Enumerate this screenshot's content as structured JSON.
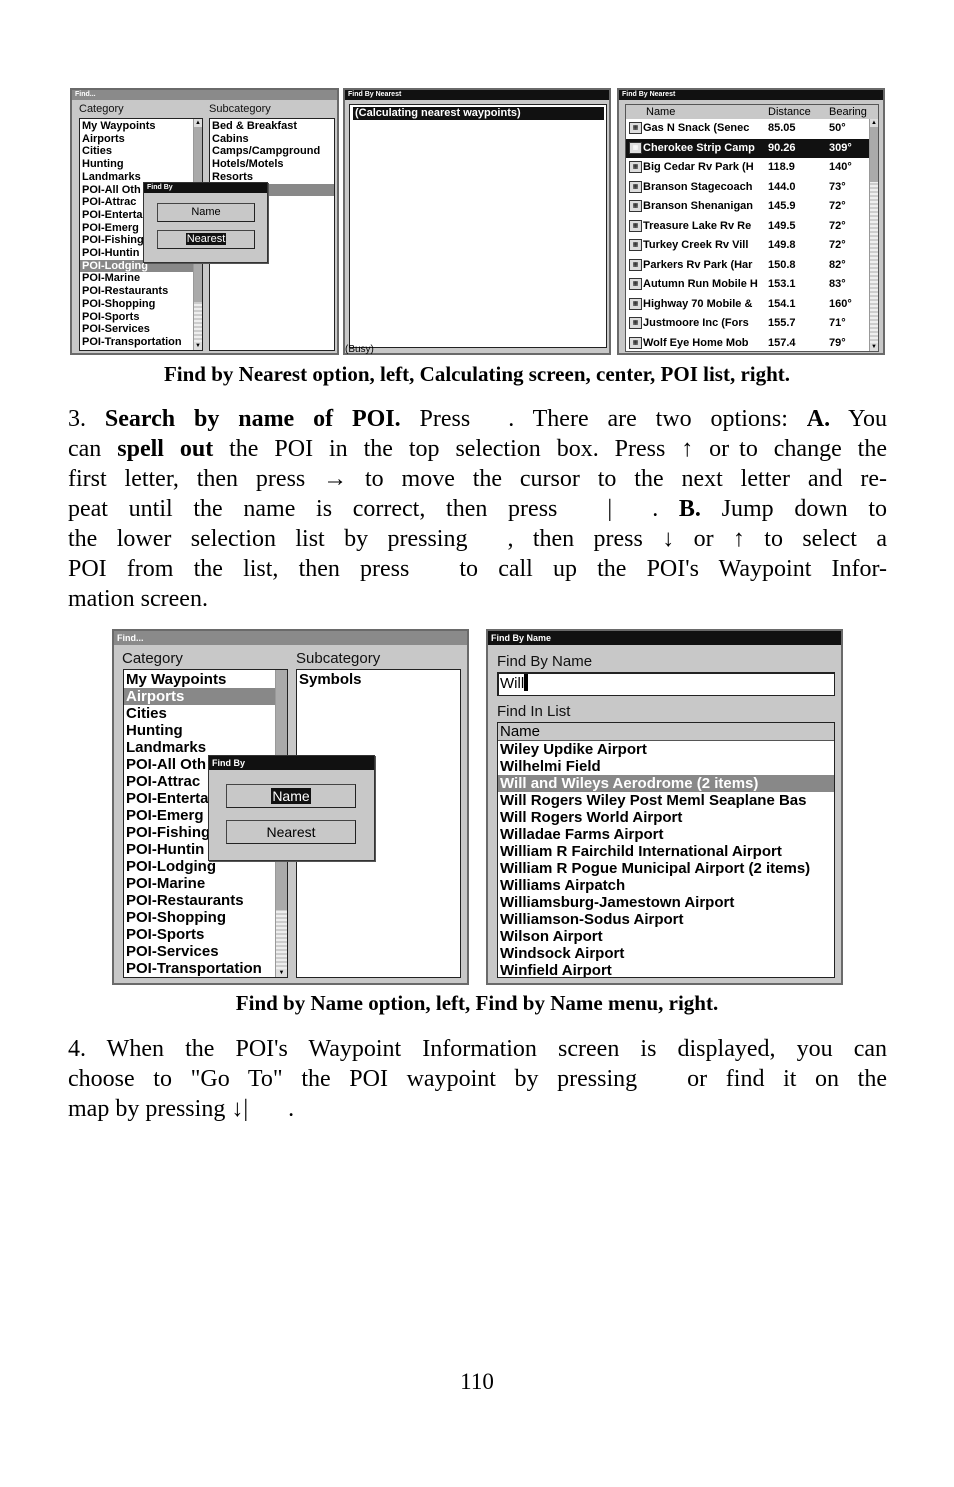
{
  "fig1": {
    "left": {
      "title": "Find...",
      "category_label": "Category",
      "subcategory_label": "Subcategory",
      "categories": [
        "My Waypoints",
        "Airports",
        "Cities",
        "Hunting",
        "Landmarks",
        "POI-All Oth",
        "POI-Attrac",
        "POI-Enterta",
        "POI-Emerg",
        "POI-Fishing",
        "POI-Huntin",
        "POI-Lodging",
        "POI-Marine",
        "POI-Restaurants",
        "POI-Shopping",
        "POI-Sports",
        "POI-Services",
        "POI-Transportation"
      ],
      "selected_category": "POI-Lodging",
      "subcategories": [
        "Bed & Breakfast",
        "Cabins",
        "Camps/Campground",
        "Hotels/Motels",
        "Resorts",
        ""
      ],
      "popup": {
        "title": "Find By",
        "name_button": "Name",
        "nearest_button": "Nearest",
        "focused": "Nearest"
      }
    },
    "center": {
      "title": "Find By Nearest",
      "status_row": "(Calculating nearest waypoints)",
      "busy": "(Busy)"
    },
    "right": {
      "title": "Find By Nearest",
      "columns": [
        "Name",
        "Distance",
        "Bearing"
      ],
      "rows": [
        {
          "name": "Gas N Snack (Senec",
          "distance": "85.05",
          "bearing": "50°"
        },
        {
          "name": "Cherokee Strip Camp",
          "distance": "90.26",
          "bearing": "309°"
        },
        {
          "name": "Big Cedar Rv Park (H",
          "distance": "118.9",
          "bearing": "140°"
        },
        {
          "name": "Branson Stagecoach",
          "distance": "144.0",
          "bearing": "73°"
        },
        {
          "name": "Branson Shenanigan",
          "distance": "145.9",
          "bearing": "72°"
        },
        {
          "name": "Treasure Lake Rv Re",
          "distance": "149.5",
          "bearing": "72°"
        },
        {
          "name": "Turkey Creek Rv Vill",
          "distance": "149.8",
          "bearing": "72°"
        },
        {
          "name": "Parkers Rv Park (Har",
          "distance": "150.8",
          "bearing": "82°"
        },
        {
          "name": "Autumn Run Mobile H",
          "distance": "153.1",
          "bearing": "83°"
        },
        {
          "name": "Highway 70 Mobile &",
          "distance": "154.1",
          "bearing": "160°"
        },
        {
          "name": "Justmoore Inc (Fors",
          "distance": "155.7",
          "bearing": "71°"
        },
        {
          "name": "Wolf Eye Home Mob",
          "distance": "157.4",
          "bearing": "79°"
        }
      ],
      "selected_index": 1
    },
    "caption": "Find by Nearest option, left, Calculating screen, center, POI list, right."
  },
  "para3": [
    [
      {
        "t": "3. "
      },
      {
        "t": "Search by name of POI.",
        "b": true
      },
      {
        "t": " Press"
      },
      {
        "gap": 38
      },
      {
        "t": ". There are two options: "
      },
      {
        "t": "A.",
        "b": true
      },
      {
        "t": " You"
      }
    ],
    [
      {
        "t": "can "
      },
      {
        "t": "spell out",
        "b": true
      },
      {
        "t": " the POI in the top selection box. Press ↑ or"
      },
      {
        "gap": 10
      },
      {
        "t": "to change the"
      }
    ],
    [
      {
        "t": "first letter, then press → to move the cursor to the next letter and re-"
      }
    ],
    [
      {
        "t": "peat until the name is correct, then press"
      },
      {
        "gap": 50
      },
      {
        "t": "|"
      },
      {
        "gap": 40
      },
      {
        "t": ". "
      },
      {
        "t": "B.",
        "b": true
      },
      {
        "t": " Jump down to"
      }
    ],
    [
      {
        "t": "the lower selection list by pressing"
      },
      {
        "gap": 40
      },
      {
        "t": ", then press ↓ or ↑ to select a"
      }
    ],
    [
      {
        "t": "POI from the list, then press"
      },
      {
        "gap": 50
      },
      {
        "t": "to call up the POI's Waypoint Infor-"
      }
    ],
    [
      {
        "t": "mation screen."
      }
    ]
  ],
  "fig2": {
    "left": {
      "title": "Find...",
      "category_label": "Category",
      "subcategory_label": "Subcategory",
      "categories": [
        "My Waypoints",
        "Airports",
        "Cities",
        "Hunting",
        "Landmarks",
        "POI-All Oth",
        "POI-Attrac",
        "POI-Enterta",
        "POI-Emerg",
        "POI-Fishing",
        "POI-Huntin",
        "POI-Lodging",
        "POI-Marine",
        "POI-Restaurants",
        "POI-Shopping",
        "POI-Sports",
        "POI-Services",
        "POI-Transportation"
      ],
      "selected_category": "Airports",
      "subcategories": [
        "Symbols"
      ],
      "popup": {
        "title": "Find By",
        "name_button": "Name",
        "nearest_button": "Nearest",
        "focused": "Name"
      }
    },
    "right": {
      "title": "Find By Name",
      "find_label": "Find By Name",
      "input_value": "Will",
      "list_label": "Find In List",
      "column": "Name",
      "items": [
        "Wiley Updike Airport",
        "Wilhelmi Field",
        "Will and Wileys Aerodrome (2 items)",
        "Will Rogers Wiley Post Meml Seaplane Bas",
        "Will Rogers World Airport",
        "Willadae Farms Airport",
        "William R Fairchild International Airport",
        "William R Pogue Municipal Airport (2 items)",
        "Williams Airpatch",
        "Williamsburg-Jamestown Airport",
        "Williamson-Sodus Airport",
        "Wilson Airport",
        "Windsock Airport",
        "Winfield Airport"
      ],
      "selected_index": 2
    },
    "caption": "Find by Name option, left, Find by Name menu, right."
  },
  "para4": [
    [
      {
        "t": "4. When the POI's Waypoint Information screen is displayed, you can"
      }
    ],
    [
      {
        "t": "choose to \"Go To\" the POI waypoint by pressing"
      },
      {
        "gap": 50
      },
      {
        "t": "or find it on the"
      }
    ],
    [
      {
        "t": "map by pressing ↓|"
      },
      {
        "gap": 40
      },
      {
        "t": "."
      }
    ]
  ],
  "page_number": "110"
}
